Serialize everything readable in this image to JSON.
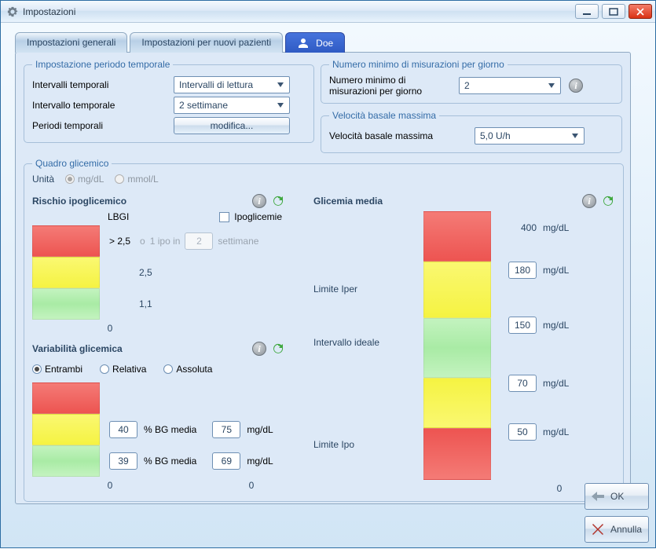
{
  "window": {
    "title": "Impostazioni"
  },
  "tabs": [
    "Impostazioni generali",
    "Impostazioni per nuovi pazienti",
    "Doe"
  ],
  "period": {
    "legend": "Impostazione periodo temporale",
    "row1_label": "Intervalli temporali",
    "row1_value": "Intervalli di lettura",
    "row2_label": "Intervallo temporale",
    "row2_value": "2 settimane",
    "row3_label": "Periodi temporali",
    "row3_button": "modifica..."
  },
  "minmeas": {
    "legend": "Numero minimo di misurazioni per giorno",
    "label": "Numero minimo di misurazioni per giorno",
    "value": "2"
  },
  "basal": {
    "legend": "Velocità basale massima",
    "label": "Velocità basale massima",
    "value": "5,0 U/h"
  },
  "quadro": {
    "legend": "Quadro glicemico",
    "unit_label": "Unità",
    "unit_mgdl": "mg/dL",
    "unit_mmol": "mmol/L",
    "hypo": {
      "title": "Rischio ipoglicemico",
      "col_lbgi": "LBGI",
      "col_ipo": "Ipoglicemie",
      "row_red": "> 2,5",
      "sep": "o",
      "ipo_pre": "1 ipo in",
      "ipo_val": "2",
      "ipo_post": "settimane",
      "row_yellow": "2,5",
      "row_green": "1,1",
      "foot": "0"
    },
    "vari": {
      "title": "Variabilità glicemica",
      "opt1": "Entrambi",
      "opt2": "Relativa",
      "opt3": "Assoluta",
      "pct_label": "% BG media",
      "mgdl": "mg/dL",
      "yellow_pct": "40",
      "yellow_mgdl": "75",
      "green_pct": "39",
      "green_mgdl": "69",
      "foot_left": "0",
      "foot_right": "0"
    },
    "gmedia": {
      "title": "Glicemia media",
      "top_val": "400",
      "unit": "mg/dL",
      "label_iper": "Limite Iper",
      "val_iper": "180",
      "label_ideal": "Intervallo ideale",
      "val_150": "150",
      "val_70": "70",
      "label_ipo": "Limite Ipo",
      "val_ipo": "50",
      "foot": "0"
    }
  },
  "buttons": {
    "ok": "OK",
    "cancel": "Annulla"
  },
  "icons": {
    "info": "i"
  }
}
